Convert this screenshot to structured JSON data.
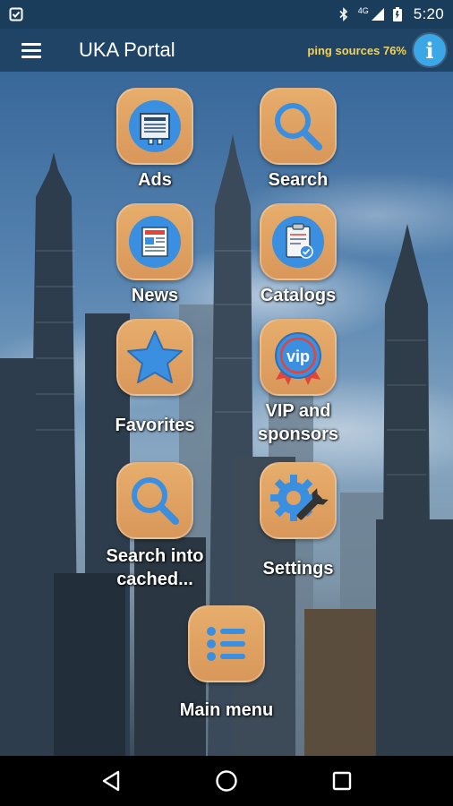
{
  "status_bar": {
    "time": "5:20",
    "network": "4G",
    "icons": [
      "download-check-icon",
      "bluetooth-icon",
      "signal-icon",
      "battery-icon"
    ]
  },
  "app_bar": {
    "title": "UKA Portal",
    "ping_label": "ping sources",
    "ping_percent": "76%",
    "info_label": "i"
  },
  "tiles": [
    {
      "label": "Ads",
      "icon": "newspaper-ad-icon"
    },
    {
      "label": "Search",
      "icon": "magnifier-icon"
    },
    {
      "label": "News",
      "icon": "news-icon"
    },
    {
      "label": "Catalogs",
      "icon": "catalog-clipboard-icon"
    },
    {
      "label": "Favorites",
      "icon": "star-icon"
    },
    {
      "label": "VIP and\nsponsors",
      "label_line1": "VIP and",
      "label_line2": "sponsors",
      "icon": "vip-badge-icon"
    },
    {
      "label": "Search into\ncached...",
      "label_line1": "Search into",
      "label_line2": "cached...",
      "icon": "magnifier-icon"
    },
    {
      "label": "Settings",
      "icon": "gear-wrench-icon"
    },
    {
      "label": "Main menu",
      "icon": "list-menu-icon"
    }
  ],
  "colors": {
    "status_bar": "#1b3d5c",
    "app_bar": "#1f4466",
    "tile": "#e0a263",
    "icon_blue": "#3a8fe0",
    "ping_text": "#f3d35a"
  }
}
